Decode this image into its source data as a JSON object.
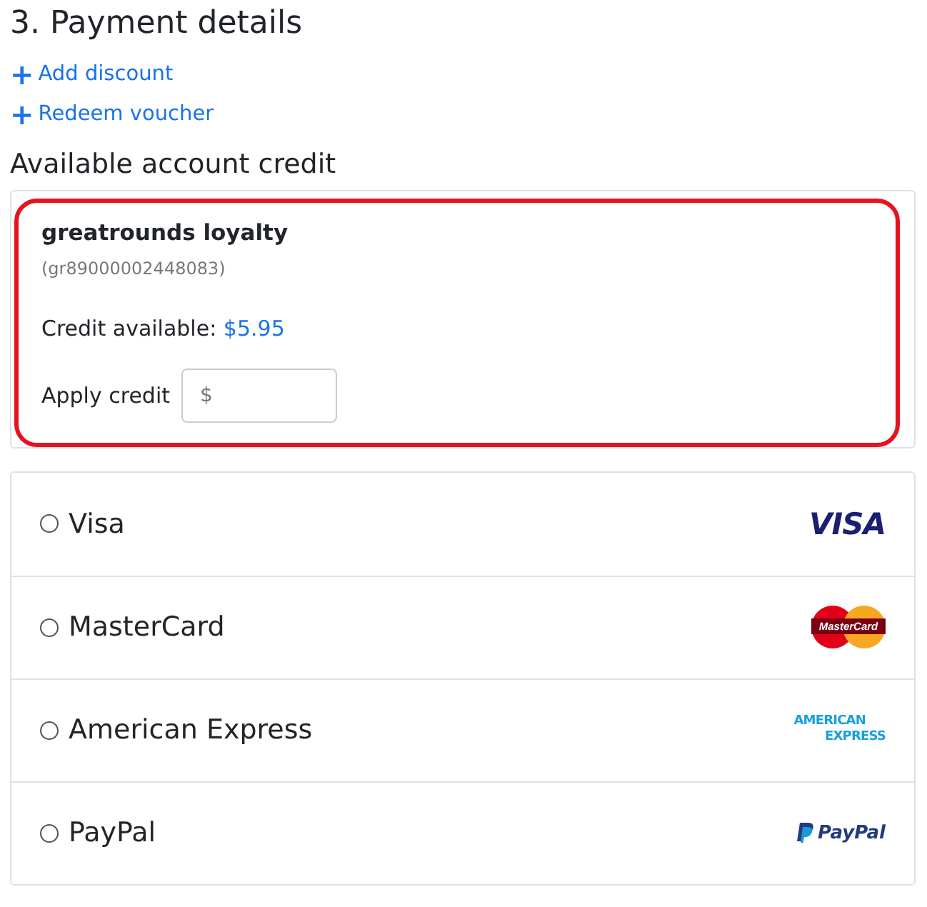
{
  "heading": "3. Payment details",
  "actions": [
    {
      "icon": "+",
      "label": "Add discount"
    },
    {
      "icon": "+",
      "label": "Redeem voucher"
    }
  ],
  "credit": {
    "title": "Available account credit",
    "highlighted": true,
    "account_name": "greatrounds loyalty",
    "account_id": "(gr89000002448083)",
    "available_label": "Credit available:",
    "available_amount": "$5.95",
    "apply_label": "Apply credit",
    "apply_placeholder": "$"
  },
  "payment_methods": [
    {
      "label": "Visa",
      "selected": false,
      "logo": {
        "kind": "visa",
        "lines": [
          "VISA"
        ]
      }
    },
    {
      "label": "MasterCard",
      "selected": false,
      "logo": {
        "kind": "mastercard",
        "lines": [
          "MasterCard"
        ]
      }
    },
    {
      "label": "American Express",
      "selected": false,
      "logo": {
        "kind": "amex",
        "lines": [
          "AMERICAN",
          "EXPRESS"
        ]
      }
    },
    {
      "label": "PayPal",
      "selected": false,
      "logo": {
        "kind": "paypal",
        "lines": [
          "PayPal"
        ]
      }
    }
  ]
}
